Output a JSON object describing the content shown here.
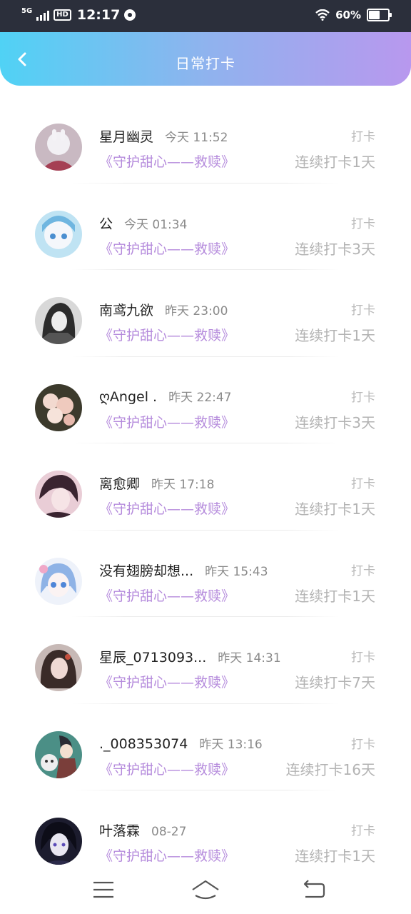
{
  "status_bar": {
    "network": "5G",
    "hd": "HD",
    "time": "12:17",
    "battery_percent": "60%",
    "battery_level": 0.6
  },
  "header": {
    "title": "日常打卡",
    "back_icon": "chevron-left-icon"
  },
  "colors": {
    "header_start": "#50d2f5",
    "header_end": "#b898ee",
    "series_link": "#b58bdc",
    "muted": "#b3b3b3"
  },
  "checkins": [
    {
      "name": "星月幽灵",
      "time": "今天 11:52",
      "tag": "打卡",
      "series": "《守护甜心——救赎》",
      "streak": "连续打卡1天"
    },
    {
      "name": "公",
      "time": "今天 01:34",
      "tag": "打卡",
      "series": "《守护甜心——救赎》",
      "streak": "连续打卡3天"
    },
    {
      "name": "南鸢九欲",
      "time": "昨天 23:00",
      "tag": "打卡",
      "series": "《守护甜心——救赎》",
      "streak": "连续打卡1天"
    },
    {
      "name": "ღAngel .",
      "time": "昨天 22:47",
      "tag": "打卡",
      "series": "《守护甜心——救赎》",
      "streak": "连续打卡3天"
    },
    {
      "name": "离愈卿",
      "time": "昨天 17:18",
      "tag": "打卡",
      "series": "《守护甜心——救赎》",
      "streak": "连续打卡1天"
    },
    {
      "name": "没有翅膀却想...",
      "time": "昨天 15:43",
      "tag": "打卡",
      "series": "《守护甜心——救赎》",
      "streak": "连续打卡1天"
    },
    {
      "name": "星辰_0713093...",
      "time": "昨天 14:31",
      "tag": "打卡",
      "series": "《守护甜心——救赎》",
      "streak": "连续打卡7天"
    },
    {
      "name": "._008353074",
      "time": "昨天 13:16",
      "tag": "打卡",
      "series": "《守护甜心——救赎》",
      "streak": "连续打卡16天"
    },
    {
      "name": "叶落霖",
      "time": "08-27",
      "tag": "打卡",
      "series": "《守护甜心——救赎》",
      "streak": "连续打卡1天"
    }
  ],
  "nav_bar": {
    "menu_icon": "menu-icon",
    "home_icon": "home-icon",
    "back_icon": "return-icon"
  }
}
